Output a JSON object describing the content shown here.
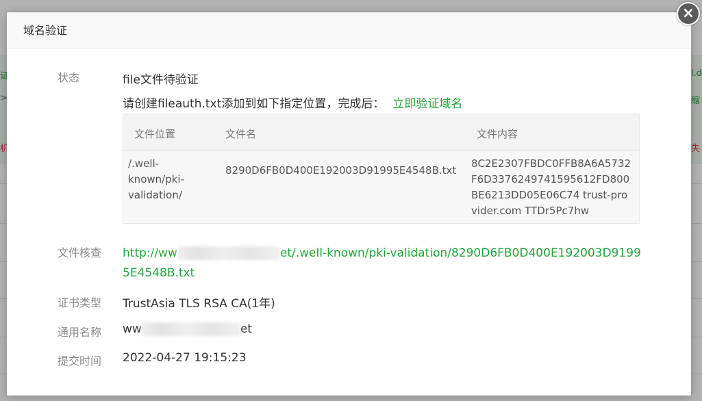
{
  "modal": {
    "title": "域名验证",
    "close_glyph": "×"
  },
  "status": {
    "label": "状态",
    "value": "file文件待验证",
    "instruction": "请创建fileauth.txt添加到如下指定位置，完成后：",
    "verify_link": "立即验证域名"
  },
  "file_table": {
    "headers": [
      "文件位置",
      "文件名",
      "文件内容"
    ],
    "rows": [
      {
        "location_lines": [
          "/.well-",
          "known/pki-",
          "validation/"
        ],
        "filename": "8290D6FB0D400E192003D91995E4548B.txt",
        "content_lines": [
          "8C2E2307FBDC0FFB8A6A5732",
          "F6D3376249741595612FD800",
          "BE6213DD05E06C74 trust-pro",
          "vider.com TTDr5Pc7hw"
        ]
      }
    ]
  },
  "file_check": {
    "label": "文件核查",
    "url_prefix": "http://ww",
    "url_suffix": "et/.well-known/pki-validation/8290D6FB0D400E192003D9199",
    "url_line2": "5E4548B.txt"
  },
  "cert_type": {
    "label": "证书类型",
    "value": "TrustAsia TLS RSA CA(1年)"
  },
  "common_name": {
    "label": "通用名称",
    "prefix": "ww",
    "suffix": "et"
  },
  "submit_time": {
    "label": "提交时间",
    "value": "2022-04-27 19:15:23"
  },
  "background": {
    "left_fragments": [
      "证",
      ">",
      "机"
    ],
    "right_fragments": [
      "l.d",
      "缩",
      "失"
    ]
  },
  "colors": {
    "accent_green": "#20a53a",
    "label_gray": "#888888",
    "close_button": "#5b5b5b"
  }
}
